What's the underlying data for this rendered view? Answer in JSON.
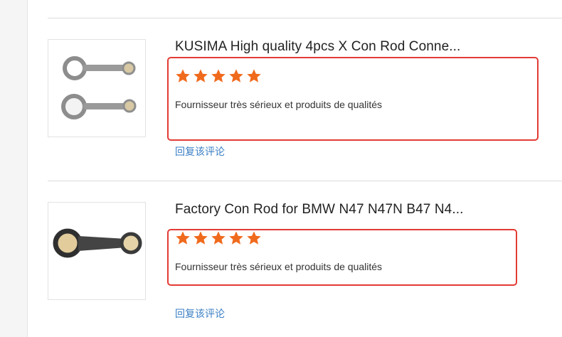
{
  "reviews": [
    {
      "product_title": "KUSIMA High quality 4pcs X Con Rod Conne...",
      "rating": 5,
      "rating_max": 5,
      "comment": "Fournisseur très sérieux et produits de qualités",
      "reply_link": "回复该评论",
      "image_icon": "connecting-rod-pair-image"
    },
    {
      "product_title": "Factory Con Rod for BMW N47 N47N B47 N4...",
      "rating": 5,
      "rating_max": 5,
      "comment": "Fournisseur très sérieux et produits de qualités",
      "reply_link": "回复该评论",
      "image_icon": "connecting-rod-image"
    }
  ],
  "colors": {
    "star": "#f06a1d",
    "highlight_box": "#e33b35",
    "reply_link": "#3b7fc4"
  }
}
